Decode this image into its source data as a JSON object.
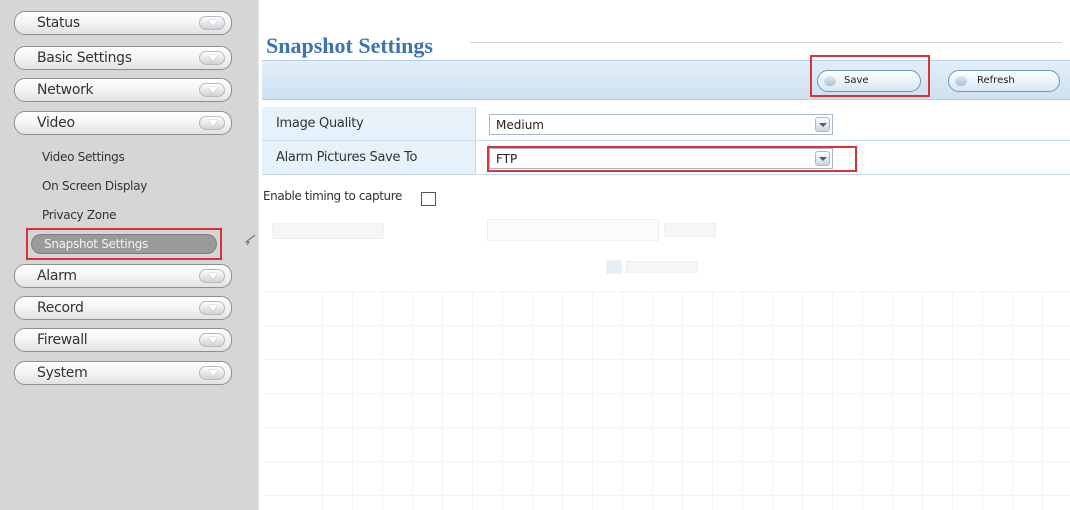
{
  "sidebar": {
    "menu": [
      {
        "label": "Status"
      },
      {
        "label": "Basic Settings"
      },
      {
        "label": "Network"
      },
      {
        "label": "Video"
      },
      {
        "label": "Alarm"
      },
      {
        "label": "Record"
      },
      {
        "label": "Firewall"
      },
      {
        "label": "System"
      }
    ],
    "video_sub": [
      {
        "label": "Video Settings"
      },
      {
        "label": "On Screen Display"
      },
      {
        "label": "Privacy Zone"
      },
      {
        "label": "Snapshot Settings",
        "active": true
      }
    ]
  },
  "page": {
    "title": "Snapshot Settings"
  },
  "toolbar": {
    "save_label": "Save",
    "refresh_label": "Refresh"
  },
  "form": {
    "image_quality": {
      "label": "Image Quality",
      "value": "Medium"
    },
    "alarm_save_to": {
      "label": "Alarm Pictures Save To",
      "value": "FTP"
    },
    "enable_timing": {
      "label": "Enable timing to capture",
      "checked": false
    }
  },
  "colors": {
    "highlight": "#d9323a",
    "title": "#3b73b3",
    "toolbar": "#cde1f1"
  }
}
